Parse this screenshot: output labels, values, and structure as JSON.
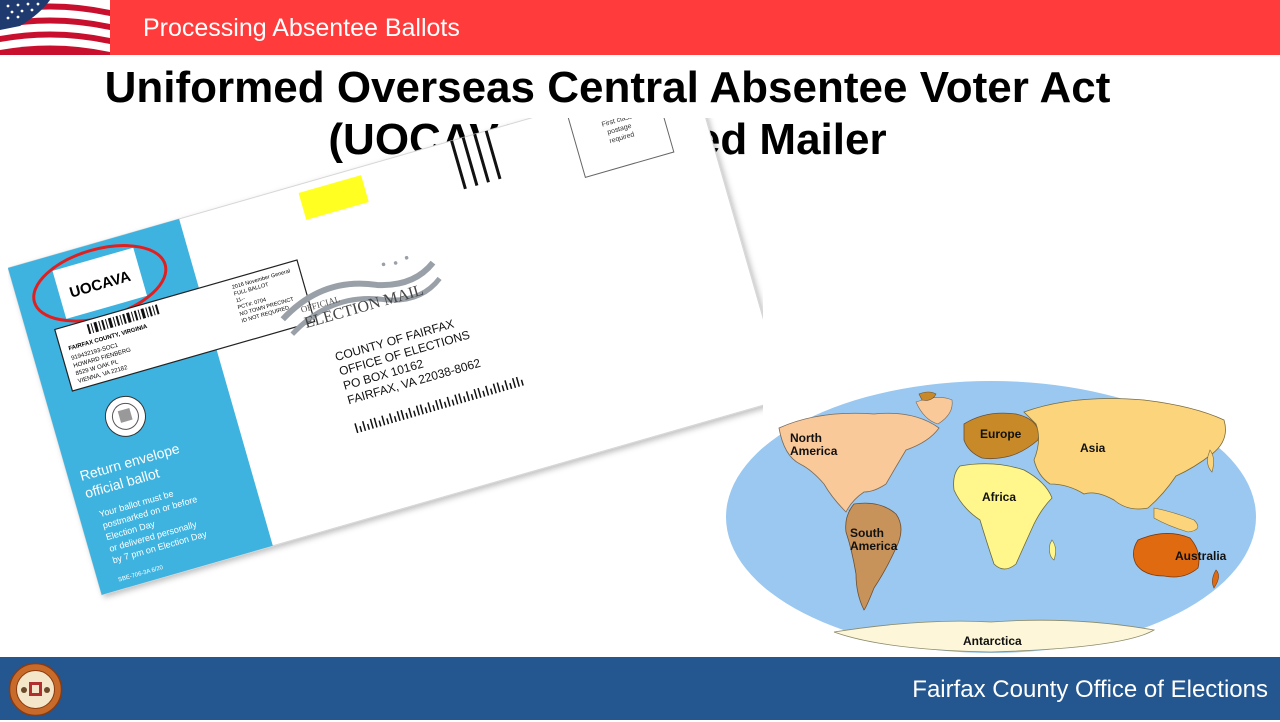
{
  "header": {
    "section_title": "Processing Absentee Ballots",
    "flag_icon": "us-flag-icon",
    "bar_color": "#ff3b3b"
  },
  "slide": {
    "title_line1": "Uniformed Overseas Central Absentee Voter Act",
    "title_line2": "(UOCAVA) Returned Mailer"
  },
  "envelope": {
    "uocava_label": "UOCAVA",
    "postage_line1": "First class",
    "postage_line2": "postage",
    "postage_line3": "required",
    "label_county": "FAIRFAX COUNTY, VIRGINIA",
    "label_voter_id": "919432193-SOC1",
    "label_name": "HOWARD FIENBERG",
    "label_street": "8529 W OAK PL",
    "label_city": "VIENNA, VA 22182",
    "label_election": "2016 November General",
    "label_ballot": "FULL BALLOT",
    "label_num": "11--",
    "label_pct": "PCT#: 0704",
    "label_precinct": "NO TOWN PRECINCT",
    "label_id": "ID NOT REQUIRED",
    "election_mail_official": "OFFICIAL",
    "election_mail": "ELECTION MAIL",
    "addr_line1": "COUNTY OF FAIRFAX",
    "addr_line2": "OFFICE OF ELECTIONS",
    "addr_line3": "PO BOX 10162",
    "addr_line4": "FAIRFAX, VA 22038-8062",
    "return_line1": "Return envelope",
    "return_line2": "official ballot",
    "instr_line1": "Your ballot must be",
    "instr_line2": "postmarked on or before",
    "instr_line3": "Election Day",
    "instr_line4": "or delivered personally",
    "instr_line5": "by 7 pm on Election Day",
    "form_code": "SBE-706-3A 6/20",
    "flap_color": "#3eb3e0"
  },
  "map": {
    "labels": [
      "North America",
      "Europe",
      "Asia",
      "Africa",
      "South America",
      "Australia",
      "Antarctica"
    ],
    "ocean_color": "#9ac8f0"
  },
  "footer": {
    "org": "Fairfax County Office of Elections",
    "seal_icon": "fairfax-county-seal-icon",
    "bar_color": "#24568f"
  }
}
